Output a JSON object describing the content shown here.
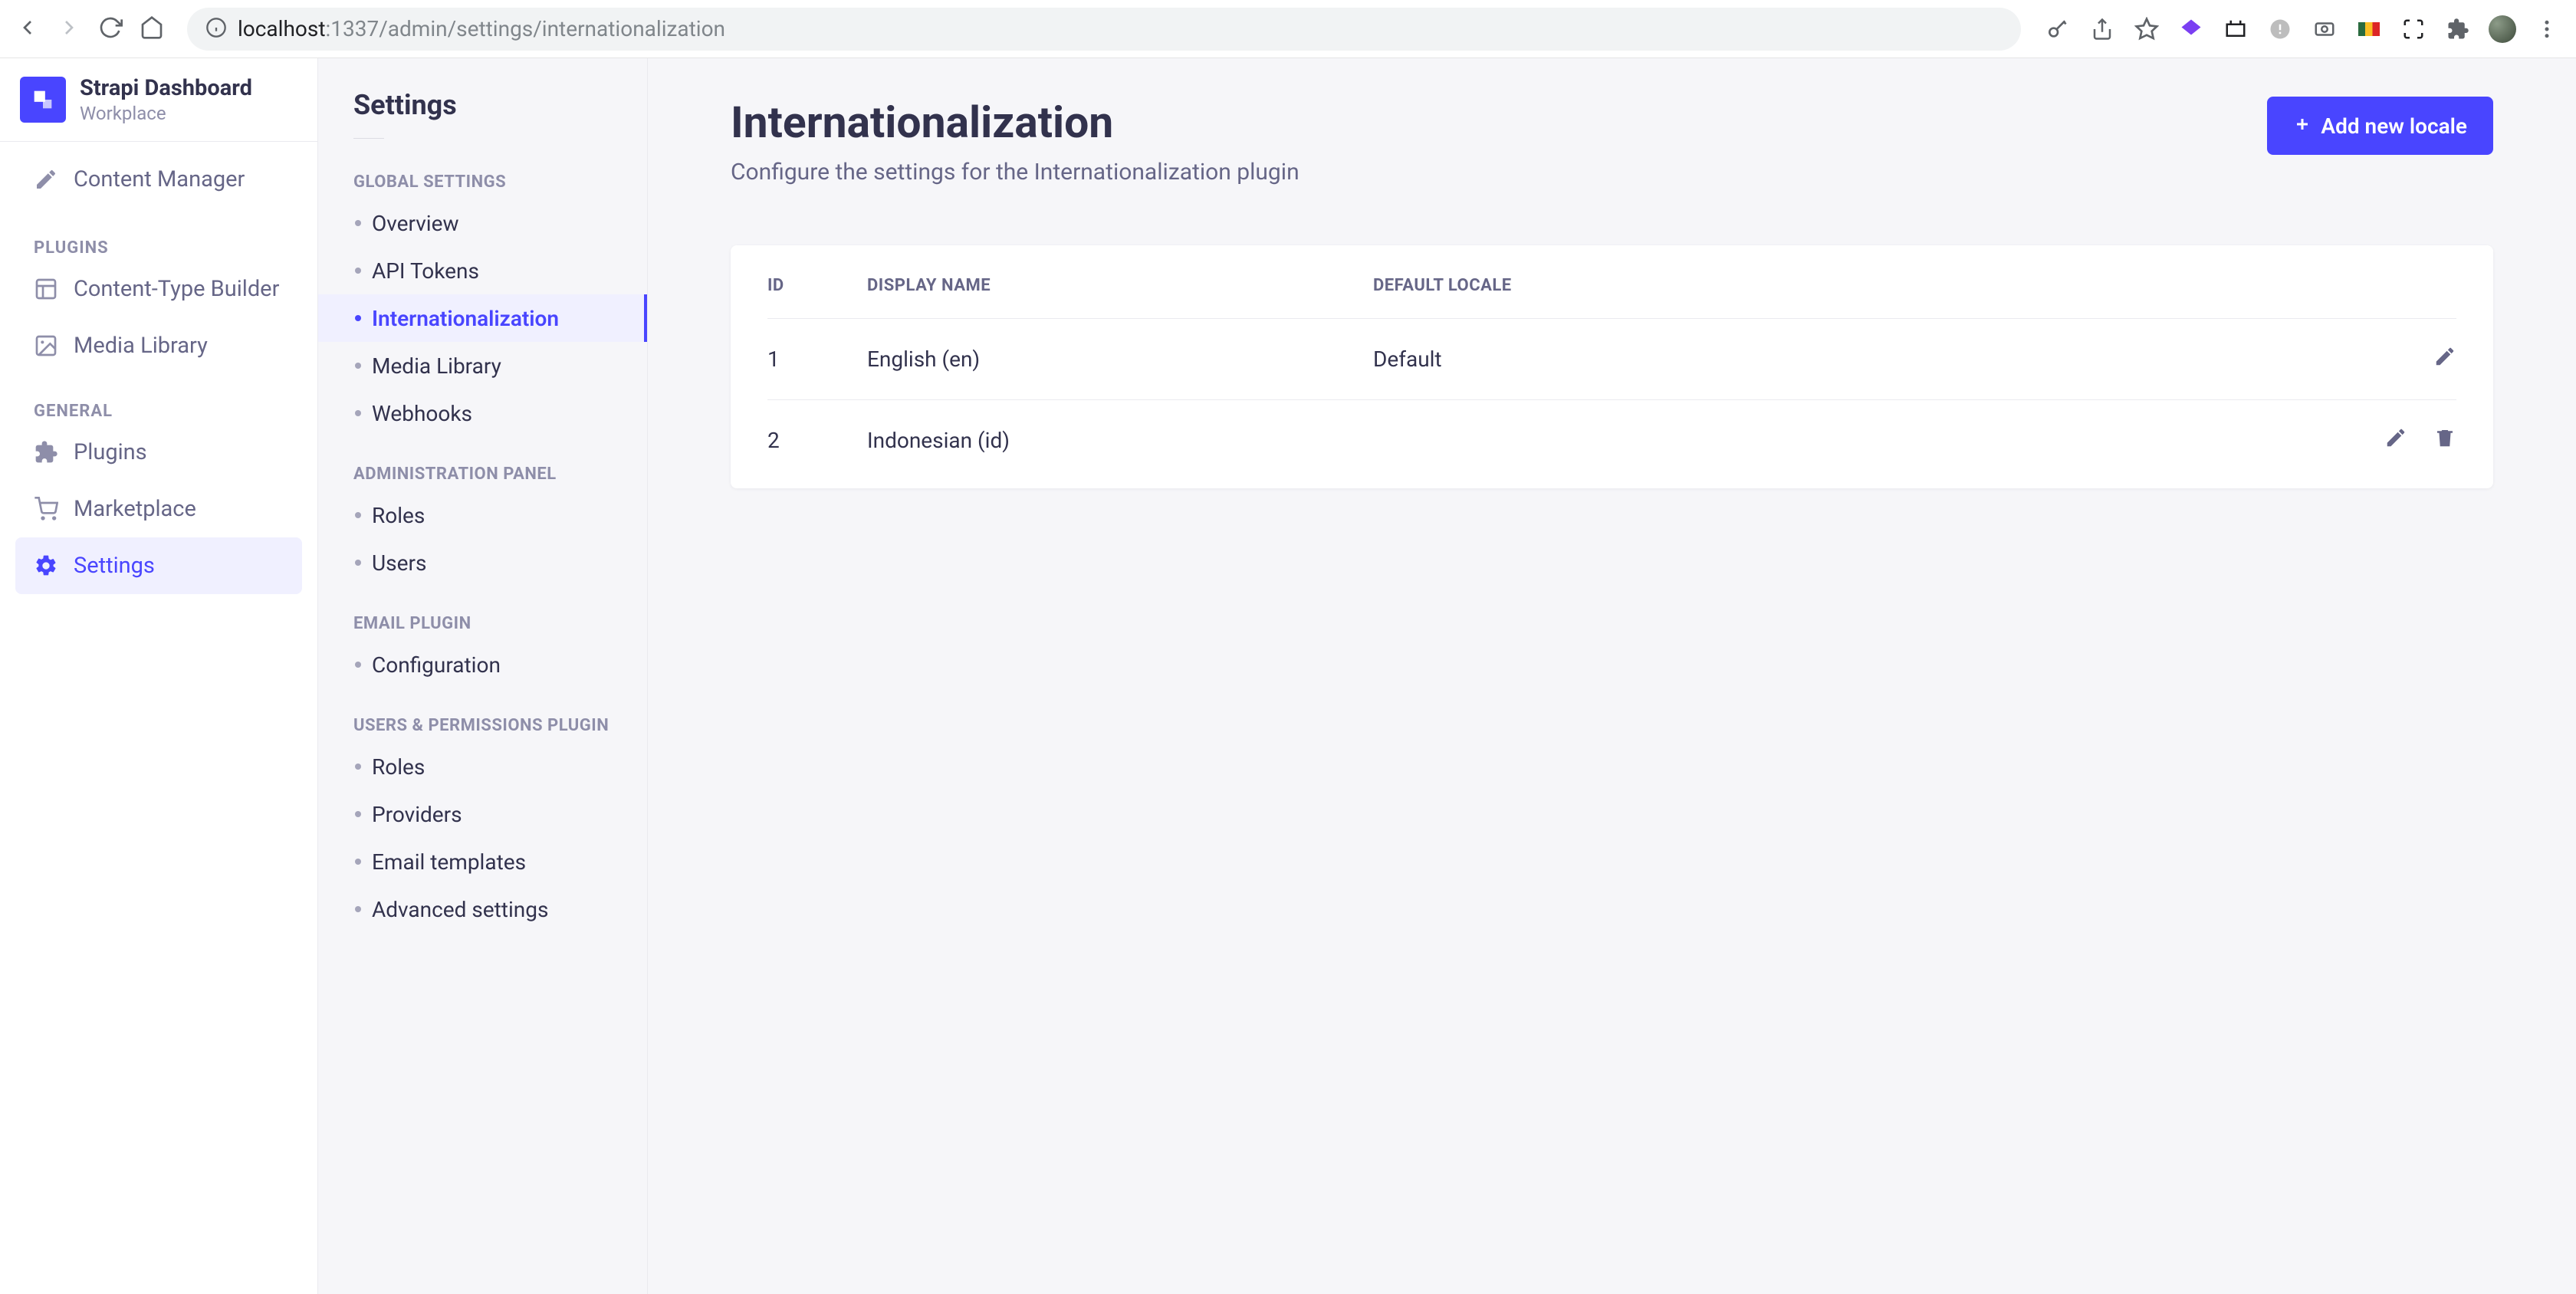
{
  "chrome": {
    "url_host": "localhost",
    "url_port": ":1337",
    "url_path": "/admin/settings/internationalization"
  },
  "brand": {
    "title": "Strapi Dashboard",
    "subtitle": "Workplace"
  },
  "left_nav": {
    "content_manager": "Content Manager",
    "plugins_label": "PLUGINS",
    "ctb": "Content-Type Builder",
    "media_library": "Media Library",
    "general_label": "GENERAL",
    "plugins": "Plugins",
    "marketplace": "Marketplace",
    "settings": "Settings"
  },
  "sub_nav": {
    "title": "Settings",
    "groups": [
      {
        "label": "GLOBAL SETTINGS",
        "items": [
          "Overview",
          "API Tokens",
          "Internationalization",
          "Media Library",
          "Webhooks"
        ],
        "active_index": 2
      },
      {
        "label": "ADMINISTRATION PANEL",
        "items": [
          "Roles",
          "Users"
        ]
      },
      {
        "label": "EMAIL PLUGIN",
        "items": [
          "Configuration"
        ]
      },
      {
        "label": "USERS & PERMISSIONS PLUGIN",
        "items": [
          "Roles",
          "Providers",
          "Email templates",
          "Advanced settings"
        ]
      }
    ]
  },
  "page": {
    "title": "Internationalization",
    "description": "Configure the settings for the Internationalization plugin",
    "add_button": "Add new locale"
  },
  "table": {
    "columns": {
      "id": "ID",
      "display_name": "DISPLAY NAME",
      "default_locale": "DEFAULT LOCALE"
    },
    "rows": [
      {
        "id": "1",
        "display_name": "English (en)",
        "default_locale": "Default",
        "can_delete": false
      },
      {
        "id": "2",
        "display_name": "Indonesian (id)",
        "default_locale": "",
        "can_delete": true
      }
    ]
  }
}
